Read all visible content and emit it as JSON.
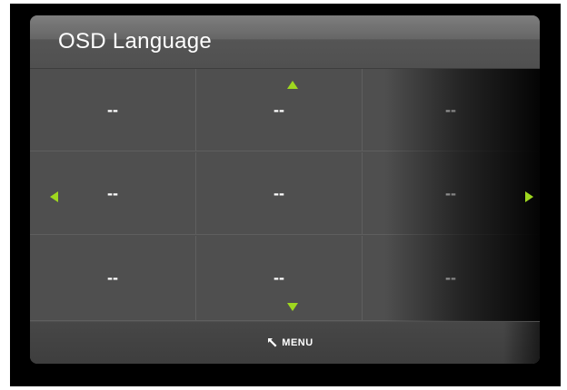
{
  "window": {
    "title": "OSD Language"
  },
  "grid": {
    "rows": [
      [
        "--",
        "--",
        "--"
      ],
      [
        "--",
        "--",
        "--"
      ],
      [
        "--",
        "--",
        "--"
      ]
    ]
  },
  "footer": {
    "menu_label": "MENU",
    "menu_icon": "return-arrow-icon"
  },
  "colors": {
    "arrow_accent": "#9fd81f",
    "panel_bg": "#4f4f4f",
    "text": "#ffffff"
  }
}
